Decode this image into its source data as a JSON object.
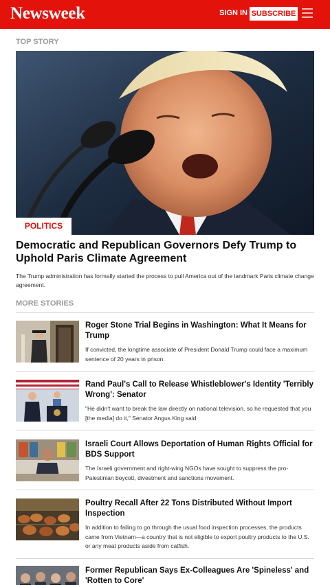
{
  "header": {
    "logo": "Newsweek",
    "sign_in": "SIGN IN",
    "subscribe": "SUBSCRIBE",
    "menu_icon": "hamburger-icon",
    "bar_color": "#e3120b"
  },
  "top_story": {
    "section_label": "TOP STORY",
    "tag": "POLITICS",
    "title": "Democratic and Republican Governors Defy Trump to Uphold Paris Climate Agreement",
    "description": "The Trump administration has formally started the process to pull America out of the landmark Paris climate change agreement."
  },
  "more_stories": {
    "section_label": "MORE STORIES",
    "items": [
      {
        "title": "Roger Stone Trial Begins in Washington: What It Means for Trump",
        "description": "If convicted, the longtime associate of President Donald Trump could face a maximum sentence of 20 years in prison."
      },
      {
        "title": "Rand Paul's Call to Release Whistleblower's Identity 'Terribly Wrong': Senator",
        "description": "\"He didn't want to break the law directly on national television, so he requested that you [the media] do it,\" Senator Angus King said."
      },
      {
        "title": "Israeli Court Allows Deportation of Human Rights Official for BDS Support",
        "description": "The Israeli government and right-wing NGOs have sought to suppress the pro-Palestinian boycott, divestment and sanctions movement."
      },
      {
        "title": "Poultry Recall After 22 Tons Distributed Without Import Inspection",
        "description": "In addition to failing to go through the usual food inspection processes, the products came from Vietnam—a country that is not eligible to export poultry products to the U.S. or any meat products aside from catfish."
      },
      {
        "title": "Former Republican Says Ex-Colleagues Are 'Spineless' and 'Rotten to Core'",
        "description": ""
      }
    ]
  }
}
